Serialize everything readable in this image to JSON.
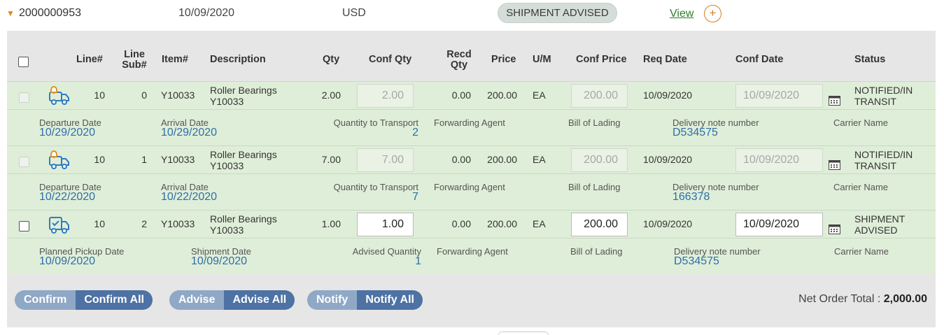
{
  "order": {
    "number": "2000000953",
    "date": "10/09/2020",
    "currency": "USD",
    "status": "SHIPMENT ADVISED",
    "view_label": "View",
    "plus_label": "+"
  },
  "columns": {
    "line": "Line#",
    "line_sub_1": "Line",
    "line_sub_2": "Sub#",
    "item": "Item#",
    "description": "Description",
    "qty": "Qty",
    "conf_qty": "Conf Qty",
    "recd_qty_1": "Recd",
    "recd_qty_2": "Qty",
    "price": "Price",
    "um": "U/M",
    "conf_price": "Conf Price",
    "req_date": "Req Date",
    "conf_date": "Conf Date",
    "status": "Status"
  },
  "lines": [
    {
      "line": "10",
      "sub": "0",
      "item": "Y10033",
      "desc_1": "Roller Bearings",
      "desc_2": "Y10033",
      "qty": "2.00",
      "conf_qty": "2.00",
      "recd_qty": "0.00",
      "price": "200.00",
      "um": "EA",
      "conf_price": "200.00",
      "req_date": "10/09/2020",
      "conf_date": "10/09/2020",
      "status_1": "NOTIFIED/IN",
      "status_2": "TRANSIT",
      "icon": "truck-notified-icon",
      "details": {
        "l1": "Departure Date",
        "v1": "10/29/2020",
        "l2": "Arrival Date",
        "v2": "10/29/2020",
        "l3": "Quantity to Transport",
        "v3": "2",
        "l4": "Forwarding Agent",
        "l5": "Bill of Lading",
        "l6": "Delivery note number",
        "v6": "D534575",
        "l7": "Carrier Name"
      }
    },
    {
      "line": "10",
      "sub": "1",
      "item": "Y10033",
      "desc_1": "Roller Bearings",
      "desc_2": "Y10033",
      "qty": "7.00",
      "conf_qty": "7.00",
      "recd_qty": "0.00",
      "price": "200.00",
      "um": "EA",
      "conf_price": "200.00",
      "req_date": "10/09/2020",
      "conf_date": "10/09/2020",
      "status_1": "NOTIFIED/IN",
      "status_2": "TRANSIT",
      "icon": "truck-notified-icon",
      "details": {
        "l1": "Departure Date",
        "v1": "10/22/2020",
        "l2": "Arrival Date",
        "v2": "10/22/2020",
        "l3": "Quantity to Transport",
        "v3": "7",
        "l4": "Forwarding Agent",
        "l5": "Bill of Lading",
        "l6": "Delivery note number",
        "v6": "166378",
        "l7": "Carrier Name"
      }
    },
    {
      "line": "10",
      "sub": "2",
      "item": "Y10033",
      "desc_1": "Roller Bearings",
      "desc_2": "Y10033",
      "qty": "1.00",
      "conf_qty": "1.00",
      "recd_qty": "0.00",
      "price": "200.00",
      "um": "EA",
      "conf_price": "200.00",
      "req_date": "10/09/2020",
      "conf_date": "10/09/2020",
      "status_1": "SHIPMENT",
      "status_2": "ADVISED",
      "icon": "truck-advised-icon",
      "details": {
        "l1": "Planned Pickup Date",
        "v1": "10/09/2020",
        "l2": "Shipment Date",
        "v2": "10/09/2020",
        "l3": "Advised Quantity",
        "v3": "1",
        "l4": "Forwarding Agent",
        "l5": "Bill of Lading",
        "l6": "Delivery note number",
        "v6": "D534575",
        "l7": "Carrier Name"
      }
    }
  ],
  "actions": {
    "confirm": "Confirm",
    "confirm_all": "Confirm All",
    "advise": "Advise",
    "advise_all": "Advise All",
    "notify": "Notify",
    "notify_all": "Notify All"
  },
  "totals": {
    "label": "Net Order Total :",
    "value": "2,000.00"
  },
  "colors": {
    "row_bg": "#dfeed8",
    "panel_bg": "#e6e6e6",
    "accent_orange": "#e08a1e",
    "link_blue": "#2f6ea8",
    "button_dark": "#4d72a3",
    "button_light": "#8fa8c6"
  }
}
